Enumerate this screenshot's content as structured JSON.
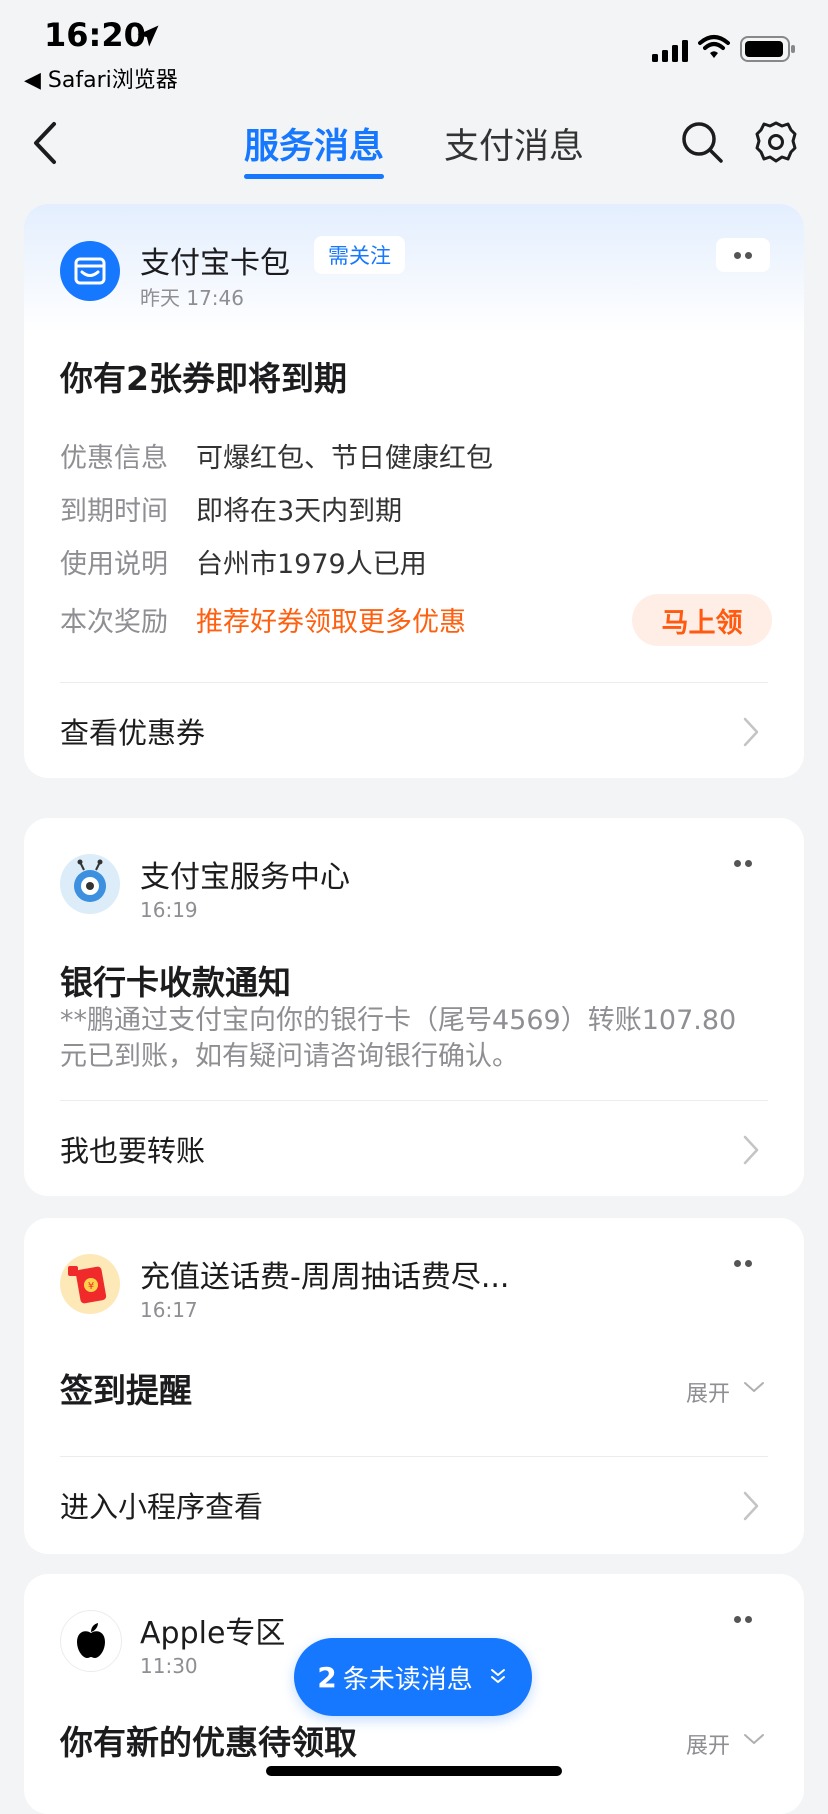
{
  "status": {
    "time": "16:20",
    "back_app": "◀ Safari浏览器"
  },
  "tabs": [
    {
      "label": "服务消息"
    },
    {
      "label": "支付消息"
    }
  ],
  "colors": {
    "accent": "#1677ff",
    "orange": "#ff6010"
  },
  "card1": {
    "sender": "支付宝卡包",
    "badge": "需关注",
    "time": "昨天 17:46",
    "title": "你有2张券即将到期",
    "rows": [
      {
        "label": "优惠信息",
        "value": "可爆红包、节日健康红包"
      },
      {
        "label": "到期时间",
        "value": "即将在3天内到期"
      },
      {
        "label": "使用说明",
        "value": "台州市1979人已用"
      },
      {
        "label": "本次奖励",
        "value": "推荐好券领取更多优惠"
      }
    ],
    "claim_button": "马上领",
    "footer_link": "查看优惠券"
  },
  "card2": {
    "sender": "支付宝服务中心",
    "time": "16:19",
    "title": "银行卡收款通知",
    "body_line1": "**鹏通过支付宝向你的银行卡（尾号4569）转账107.80",
    "body_line2": "元已到账，如有疑问请咨询银行确认。",
    "footer_link": "我也要转账"
  },
  "card3": {
    "sender": "充值送话费-周周抽话费尽...",
    "time": "16:17",
    "title": "签到提醒",
    "expand": "展开",
    "footer_link": "进入小程序查看"
  },
  "card4": {
    "sender": "Apple专区",
    "time": "11:30",
    "title": "你有新的优惠待领取",
    "expand": "展开"
  },
  "unread": {
    "count": "2",
    "label": "条未读消息"
  }
}
